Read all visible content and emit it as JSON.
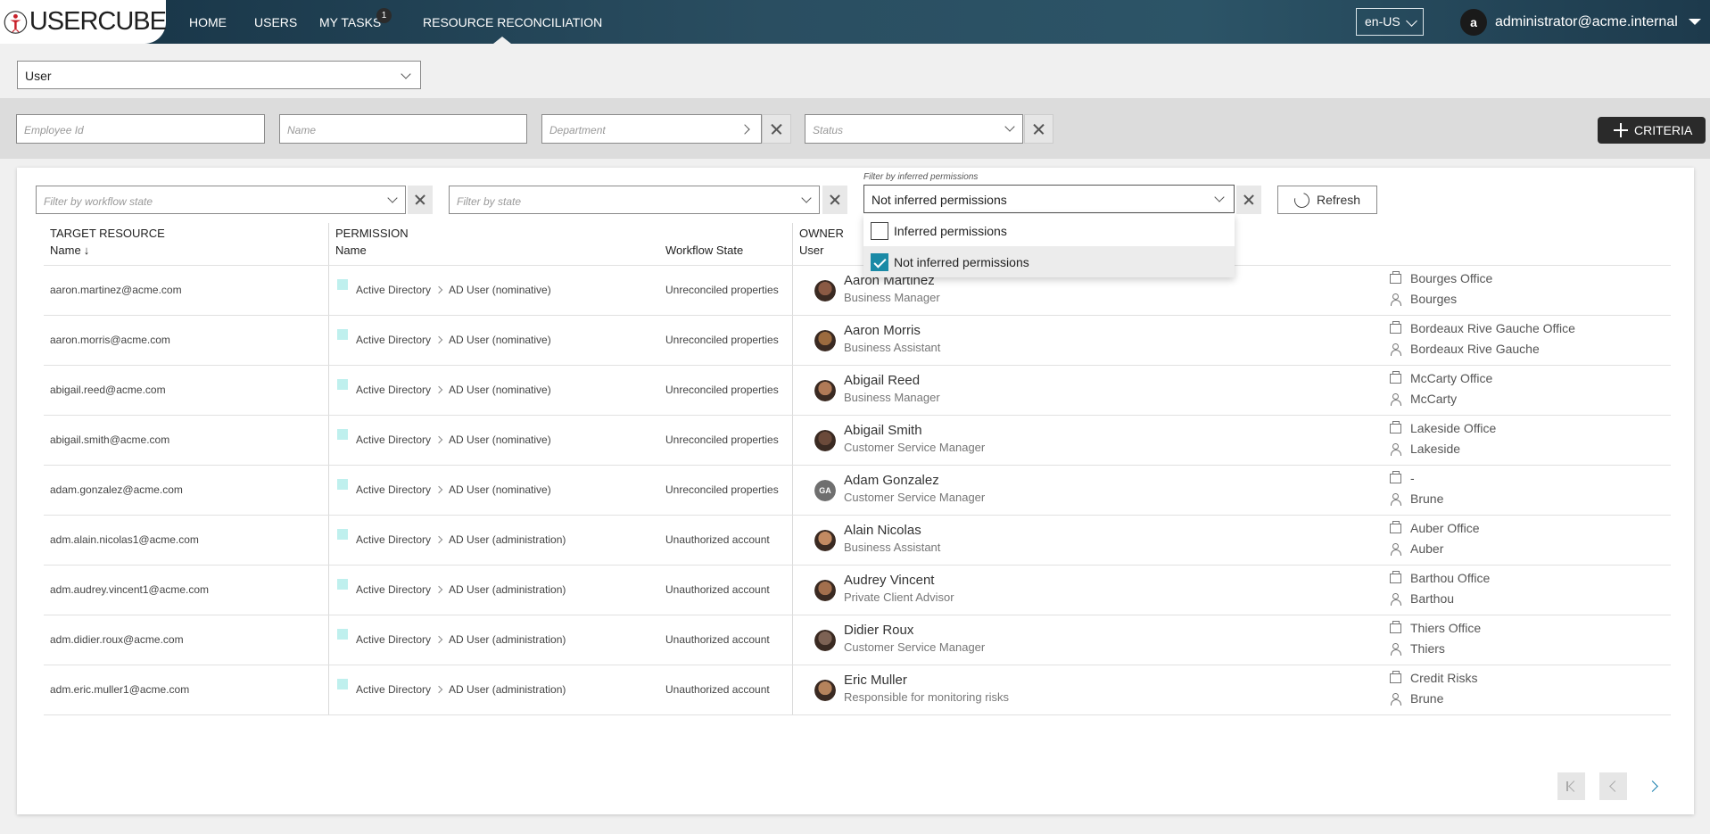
{
  "app": {
    "logo_text": "USERCUBE"
  },
  "nav": {
    "items": [
      {
        "label": "HOME"
      },
      {
        "label": "USERS"
      },
      {
        "label": "MY TASKS",
        "badge": "1"
      },
      {
        "label": "RESOURCE RECONCILIATION",
        "active": true
      }
    ]
  },
  "header": {
    "language": "en-US",
    "user_initial": "a",
    "user_email": "administrator@acme.internal"
  },
  "entity_select": {
    "value": "User"
  },
  "criteria_filters": {
    "employee_id_placeholder": "Employee Id",
    "name_placeholder": "Name",
    "department_placeholder": "Department",
    "status_placeholder": "Status",
    "criteria_button": "CRITERIA"
  },
  "grid_filters": {
    "workflow_state_placeholder": "Filter by workflow state",
    "state_placeholder": "Filter by state",
    "inferred_label": "Filter by inferred permissions",
    "inferred_value": "Not inferred permissions",
    "refresh_label": "Refresh",
    "inferred_options": [
      {
        "label": "Inferred permissions",
        "checked": false
      },
      {
        "label": "Not inferred permissions",
        "checked": true
      }
    ]
  },
  "table": {
    "headers": {
      "target_group": "TARGET RESOURCE",
      "target_name": "Name",
      "sort_indicator": "↓",
      "permission_group": "PERMISSION",
      "permission_name": "Name",
      "workflow_state": "Workflow State",
      "owner_group": "OWNER",
      "owner_user": "User"
    },
    "rows": [
      {
        "target": "aaron.martinez@acme.com",
        "perm_system": "Active Directory",
        "perm_name": "AD User (nominative)",
        "workflow_state": "Unreconciled properties",
        "owner_name": "Aaron Martinez",
        "owner_title": "Business Manager",
        "office": "Bourges Office",
        "site": "Bourges",
        "avatar": "photo",
        "avatar_color": "#8a5a44"
      },
      {
        "target": "aaron.morris@acme.com",
        "perm_system": "Active Directory",
        "perm_name": "AD User (nominative)",
        "workflow_state": "Unreconciled properties",
        "owner_name": "Aaron Morris",
        "owner_title": "Business Assistant",
        "office": "Bordeaux Rive Gauche Office",
        "site": "Bordeaux Rive Gauche",
        "avatar": "photo",
        "avatar_color": "#9c6b3f"
      },
      {
        "target": "abigail.reed@acme.com",
        "perm_system": "Active Directory",
        "perm_name": "AD User (nominative)",
        "workflow_state": "Unreconciled properties",
        "owner_name": "Abigail Reed",
        "owner_title": "Business Manager",
        "office": "McCarty Office",
        "site": "McCarty",
        "avatar": "photo",
        "avatar_color": "#b07a57"
      },
      {
        "target": "abigail.smith@acme.com",
        "perm_system": "Active Directory",
        "perm_name": "AD User (nominative)",
        "workflow_state": "Unreconciled properties",
        "owner_name": "Abigail Smith",
        "owner_title": "Customer Service Manager",
        "office": "Lakeside Office",
        "site": "Lakeside",
        "avatar": "photo",
        "avatar_color": "#6b4a3a"
      },
      {
        "target": "adam.gonzalez@acme.com",
        "perm_system": "Active Directory",
        "perm_name": "AD User (nominative)",
        "workflow_state": "Unreconciled properties",
        "owner_name": "Adam Gonzalez",
        "owner_title": "Customer Service Manager",
        "office": "-",
        "site": "Brune",
        "avatar": "initials",
        "initials": "GA",
        "avatar_color": "#6f6f6f"
      },
      {
        "target": "adm.alain.nicolas1@acme.com",
        "perm_system": "Active Directory",
        "perm_name": "AD User (administration)",
        "workflow_state": "Unauthorized account",
        "owner_name": "Alain Nicolas",
        "owner_title": "Business Assistant",
        "office": "Auber Office",
        "site": "Auber",
        "avatar": "photo",
        "avatar_color": "#c28a62"
      },
      {
        "target": "adm.audrey.vincent1@acme.com",
        "perm_system": "Active Directory",
        "perm_name": "AD User (administration)",
        "workflow_state": "Unauthorized account",
        "owner_name": "Audrey Vincent",
        "owner_title": "Private Client Advisor",
        "office": "Barthou Office",
        "site": "Barthou",
        "avatar": "photo",
        "avatar_color": "#a36f4d"
      },
      {
        "target": "adm.didier.roux@acme.com",
        "perm_system": "Active Directory",
        "perm_name": "AD User (administration)",
        "workflow_state": "Unauthorized account",
        "owner_name": "Didier Roux",
        "owner_title": "Customer Service Manager",
        "office": "Thiers Office",
        "site": "Thiers",
        "avatar": "photo",
        "avatar_color": "#7d6254"
      },
      {
        "target": "adm.eric.muller1@acme.com",
        "perm_system": "Active Directory",
        "perm_name": "AD User (administration)",
        "workflow_state": "Unauthorized account",
        "owner_name": "Eric Muller",
        "owner_title": "Responsible for monitoring risks",
        "office": "Credit Risks",
        "site": "Brune",
        "avatar": "photo",
        "avatar_color": "#b5835c"
      }
    ]
  },
  "colors": {
    "accent": "#1a8aa6",
    "topbar": "#2a4e61",
    "perm_swatch": "#bff0ee"
  }
}
